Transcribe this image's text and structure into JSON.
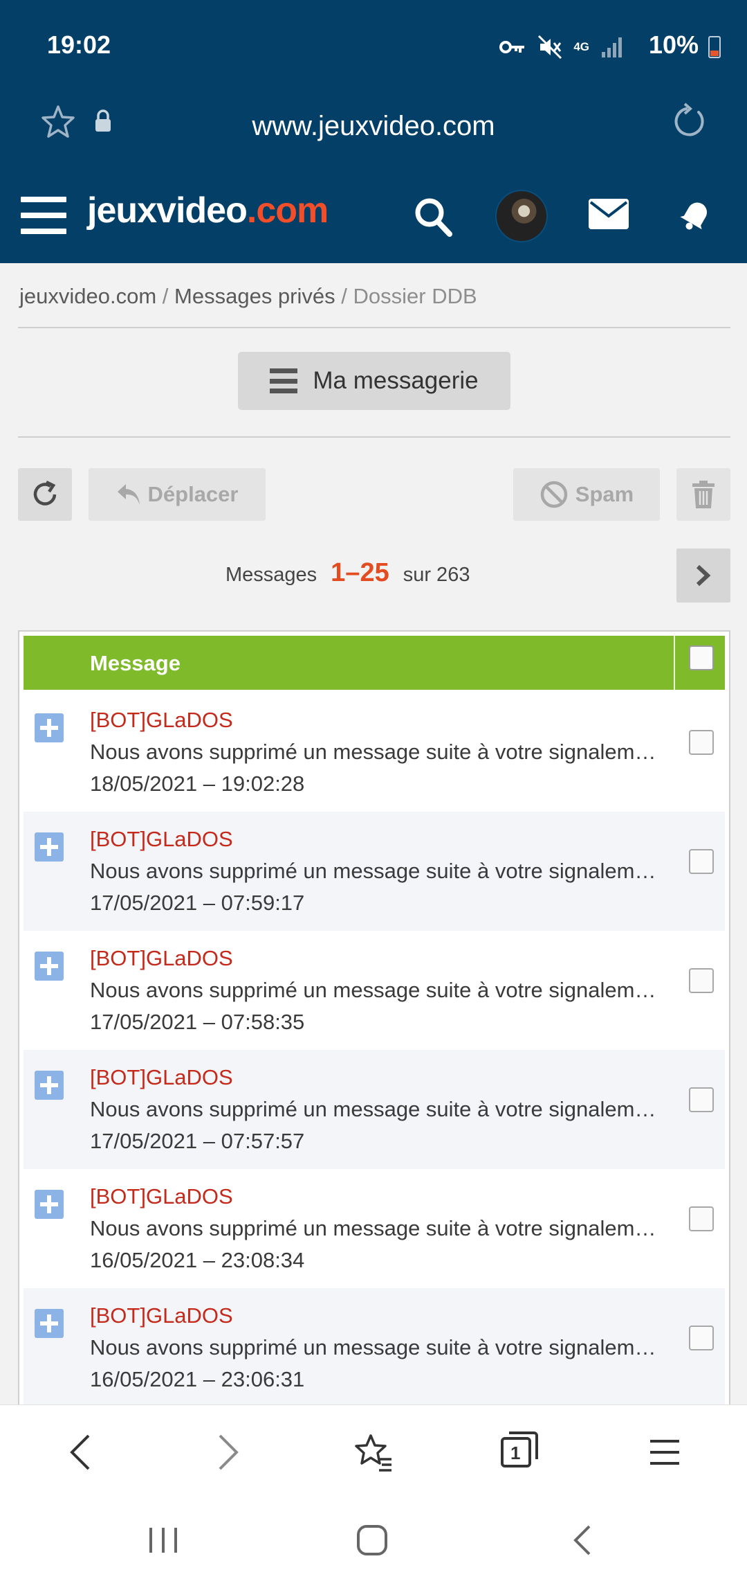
{
  "status_bar": {
    "time": "19:02",
    "network": "4G",
    "battery": "10%"
  },
  "browser": {
    "url": "www.jeuxvideo.com",
    "tabs_count": "1"
  },
  "header": {
    "logo_main": "jeuxvideo",
    "logo_suffix": ".com",
    "accent_color": "#f24e2a",
    "bg_color": "#033f66"
  },
  "breadcrumb": {
    "items": [
      "jeuxvideo.com",
      "Messages privés",
      "Dossier DDB"
    ],
    "separator": "/"
  },
  "messagerie_button": "Ma messagerie",
  "toolbar": {
    "move_label": "Déplacer",
    "spam_label": "Spam"
  },
  "pagination": {
    "prefix": "Messages",
    "range": "1–25",
    "suffix": "sur 263"
  },
  "table": {
    "header_label": "Message",
    "header_color": "#7fba2a",
    "rows": [
      {
        "author": "[BOT]GLaDOS",
        "snippet": "Nous avons supprimé un message suite à votre signalement",
        "date": "18/05/2021 – 19:02:28"
      },
      {
        "author": "[BOT]GLaDOS",
        "snippet": "Nous avons supprimé un message suite à votre signalement",
        "date": "17/05/2021 – 07:59:17"
      },
      {
        "author": "[BOT]GLaDOS",
        "snippet": "Nous avons supprimé un message suite à votre signalement",
        "date": "17/05/2021 – 07:58:35"
      },
      {
        "author": "[BOT]GLaDOS",
        "snippet": "Nous avons supprimé un message suite à votre signalement",
        "date": "17/05/2021 – 07:57:57"
      },
      {
        "author": "[BOT]GLaDOS",
        "snippet": "Nous avons supprimé un message suite à votre signalement",
        "date": "16/05/2021 – 23:08:34"
      },
      {
        "author": "[BOT]GLaDOS",
        "snippet": "Nous avons supprimé un message suite à votre signalement",
        "date": "16/05/2021 – 23:06:31"
      }
    ]
  },
  "icons": {
    "status": [
      "key-icon",
      "mute-icon",
      "network-icon",
      "signal-icon",
      "battery-icon"
    ],
    "browser_bottom": [
      "back-icon",
      "forward-icon",
      "bookmarks-icon",
      "tabs-icon",
      "menu-icon"
    ],
    "system_nav": [
      "recent-apps-icon",
      "home-icon",
      "system-back-icon"
    ]
  }
}
